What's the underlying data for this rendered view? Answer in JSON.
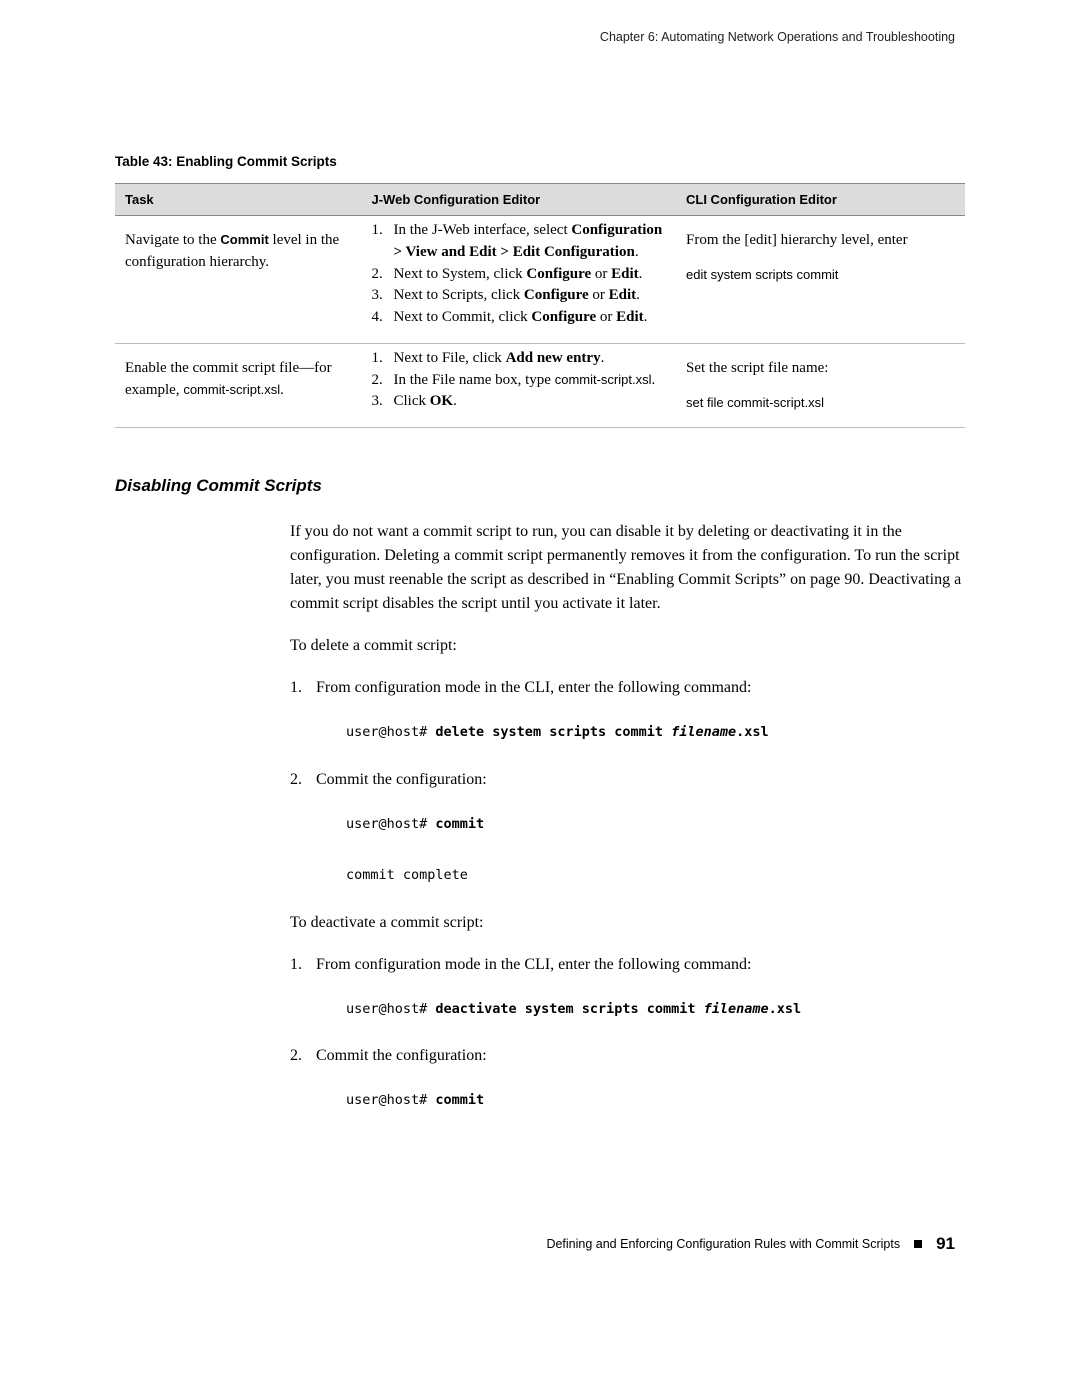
{
  "chapter_header": "Chapter 6: Automating Network Operations and Troubleshooting",
  "table_caption": "Table 43: Enabling Commit Scripts",
  "table": {
    "headers": [
      "Task",
      "J-Web Configuration Editor",
      "CLI Configuration Editor"
    ],
    "row1": {
      "task_prefix": "Navigate to the ",
      "task_bold": "Commit",
      "task_suffix": " level in the configuration hierarchy.",
      "jweb": {
        "s1_a": "In the J-Web interface, select ",
        "s1_b": "Configuration > View and Edit > Edit Configuration",
        "s1_c": ".",
        "s2_a": "Next to System, click ",
        "s2_b": "Configure",
        "s2_c": " or ",
        "s2_d": "Edit",
        "s2_e": ".",
        "s3_a": "Next to Scripts, click ",
        "s3_b": "Configure",
        "s3_c": " or ",
        "s3_d": "Edit",
        "s3_e": ".",
        "s4_a": "Next to Commit, click ",
        "s4_b": "Configure",
        "s4_c": " or ",
        "s4_d": "Edit",
        "s4_e": "."
      },
      "cli_line1": "From the [edit] hierarchy level, enter",
      "cli_line2": "edit system scripts commit"
    },
    "row2": {
      "task_a": "Enable the commit script file—for example, ",
      "task_b": "commit-script.xsl",
      "task_c": ".",
      "jweb": {
        "s1_a": "Next to File, click ",
        "s1_b": "Add new entry",
        "s1_c": ".",
        "s2_a": "In the File name box, type ",
        "s2_b": "commit-script.xsl",
        "s2_c": ".",
        "s3_a": "Click ",
        "s3_b": "OK",
        "s3_c": "."
      },
      "cli_line1": "Set the script file name:",
      "cli_line2": "set file commit-script.xsl"
    }
  },
  "section_heading": "Disabling Commit Scripts",
  "body": {
    "p1": "If you do not want a commit script to run, you can disable it by deleting or deactivating it in the configuration. Deleting a commit script permanently removes it from the configuration. To run the script later, you must reenable the script as described in “Enabling Commit Scripts” on page 90. Deactivating a commit script disables the script until you activate it later.",
    "p2": "To delete a commit script:",
    "list1": {
      "i1": "From configuration mode in the CLI, enter the following command:",
      "code1_prompt": "user@host# ",
      "code1_bold": "delete system scripts commit ",
      "code1_italic": "filename",
      "code1_bold2": ".xsl",
      "i2": "Commit the configuration:",
      "code2_prompt": "user@host# ",
      "code2_bold": "commit",
      "code2_out": "commit complete"
    },
    "p3": "To deactivate a commit script:",
    "list2": {
      "i1": "From configuration mode in the CLI, enter the following command:",
      "code1_prompt": "user@host# ",
      "code1_bold": "deactivate system scripts commit ",
      "code1_italic": "filename",
      "code1_bold2": ".xsl",
      "i2": "Commit the configuration:",
      "code2_prompt": "user@host# ",
      "code2_bold": "commit"
    }
  },
  "footer": {
    "text": "Defining and Enforcing Configuration Rules with Commit Scripts",
    "page": "91"
  }
}
